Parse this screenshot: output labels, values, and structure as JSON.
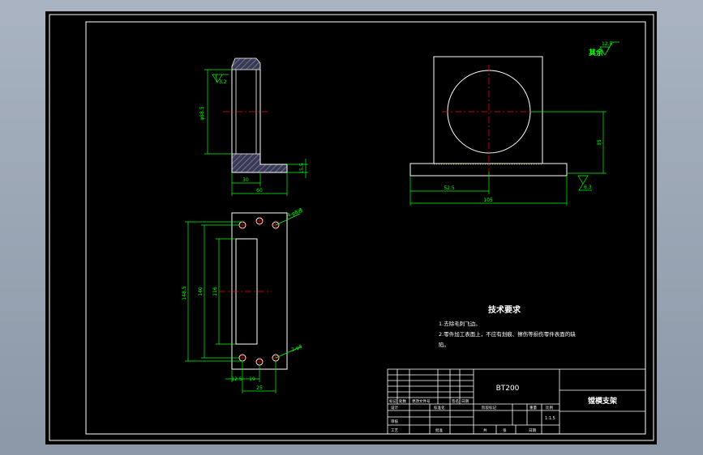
{
  "colors": {
    "background": "#000000",
    "outline": "#ffffff",
    "dimension": "#00ff00",
    "centerline": "#ff0000",
    "hatch": "#5a5a78",
    "viewport": "#9aa5b5"
  },
  "side_view": {
    "roughness": "3.2",
    "dim_vertical": "φ88.5",
    "dim_top_width": "30",
    "dim_bottom_width": "60",
    "dim_base_height": "15.5"
  },
  "front_view": {
    "roughness_other": "12.5",
    "other_label": "其余",
    "dim_height": "35",
    "dim_half_width": "52.5",
    "dim_total_width": "105",
    "roughness_base": "6.3"
  },
  "top_view": {
    "hole_note_top": "4-φ8通",
    "hole_note_bottom": "2-φ8",
    "dim_outer_height": "148.5",
    "dim_mid_height": "140",
    "dim_slot_height": "116",
    "dim_left_offset": "12.5",
    "dim_hole_pitch": "19",
    "dim_bottom_width": "25"
  },
  "tech_requirements": {
    "title": "技术要求",
    "line1": "1.去除毛刺飞边。",
    "line2": "2.零件加工表面上，不应有划痕、擦伤等损伤零件表面的缺",
    "line3": "陷。"
  },
  "title_block": {
    "part_code": "BT200",
    "part_name": "镗模支架",
    "scale": "1:1.5",
    "row_labels": [
      "标记",
      "处数",
      "更改文件号",
      "签名",
      "日期"
    ],
    "design_label": "设计",
    "check_label": "审核",
    "approve_label": "批准",
    "stage_label": "阶段标记",
    "weight_label": "重量",
    "scale_label": "比例",
    "sheet_label": "共",
    "sheet_of_label": "张",
    "process_label": "工艺",
    "std_label": "标准化",
    "date_label": "日期"
  }
}
